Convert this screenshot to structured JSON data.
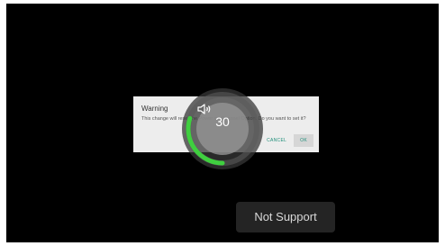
{
  "dialog": {
    "title": "Warning",
    "message": "This change will reset the Power on Channel Option. Do you want to set it?",
    "cancel_label": "CANCEL",
    "ok_label": "OK"
  },
  "volume": {
    "value": "30",
    "level": 0.3,
    "icon": "speaker-icon",
    "accent_color": "#3fcf3f"
  },
  "toast": {
    "text": "Not Support"
  }
}
